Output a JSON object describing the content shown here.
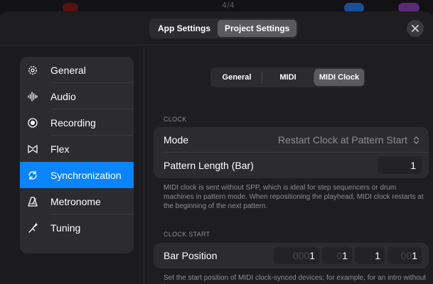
{
  "background": {
    "counter": "4/4"
  },
  "header": {
    "segments": [
      {
        "label": "App Settings",
        "active": false
      },
      {
        "label": "Project Settings",
        "active": true
      }
    ],
    "close_icon": "close-icon"
  },
  "sidebar": {
    "items": [
      {
        "label": "General",
        "icon": "gear-icon",
        "active": false
      },
      {
        "label": "Audio",
        "icon": "waveform-icon",
        "active": false
      },
      {
        "label": "Recording",
        "icon": "record-icon",
        "active": false
      },
      {
        "label": "Flex",
        "icon": "flex-icon",
        "active": false
      },
      {
        "label": "Synchronization",
        "icon": "sync-icon",
        "active": true
      },
      {
        "label": "Metronome",
        "icon": "metronome-icon",
        "active": false
      },
      {
        "label": "Tuning",
        "icon": "tuning-fork-icon",
        "active": false
      }
    ]
  },
  "content": {
    "tabs": [
      {
        "label": "General",
        "active": false
      },
      {
        "label": "MIDI",
        "active": false
      },
      {
        "label": "MIDI Clock",
        "active": true
      }
    ],
    "clock": {
      "section_label": "CLOCK",
      "mode_label": "Mode",
      "mode_value": "Restart Clock at Pattern Start",
      "pattern_length_label": "Pattern Length (Bar)",
      "pattern_length_value": "1",
      "help": "MIDI clock is sent without SPP, which is ideal for step sequencers or drum machines in pattern mode. When repositioning the playhead, MIDI clock restarts at the beginning of the next pattern."
    },
    "clock_start": {
      "section_label": "CLOCK START",
      "bar_position_label": "Bar Position",
      "bar_position": {
        "bar_prefix": "000",
        "bar": "1",
        "beat_prefix": "0",
        "beat": "1",
        "division": "1",
        "tick_prefix": "00",
        "tick": "1"
      },
      "help": "Set the start position of MIDI clock-synced devices; for example, for an intro without beats."
    }
  },
  "colors": {
    "accent": "#0a84ff",
    "panel": "#2c2c2e",
    "secondary_text": "#8e8e93"
  }
}
